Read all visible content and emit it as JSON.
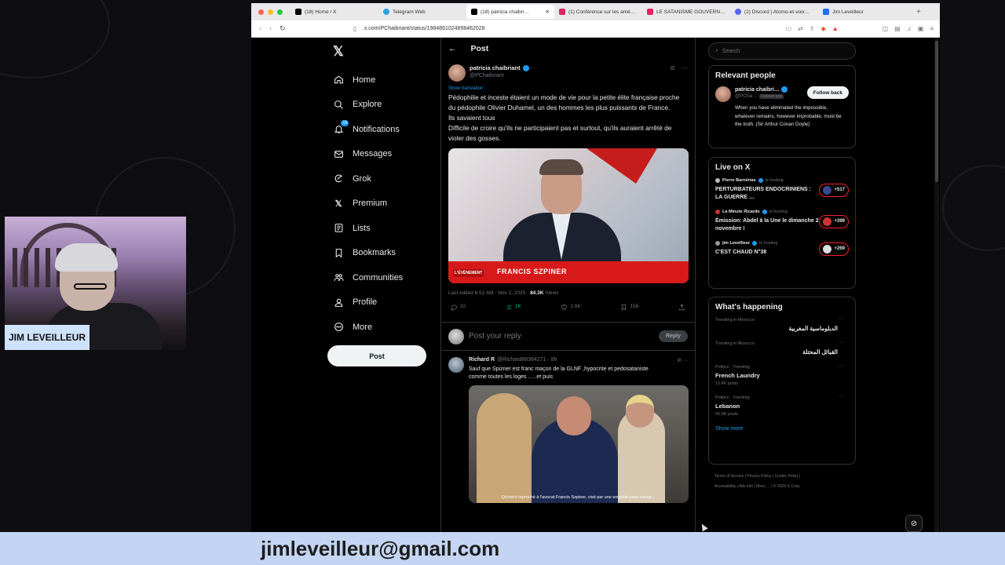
{
  "webcam": {
    "label": "JIM LEVEILLEUR"
  },
  "banner": {
    "text": "jimleveilleur@gmail.com"
  },
  "browser": {
    "tabs": [
      {
        "label": "(18) Home / X",
        "color": "#000000",
        "active": false
      },
      {
        "label": "Telegram Web",
        "color": "#2aa3df",
        "active": false
      },
      {
        "label": "(18) patricia chaibri…",
        "color": "#000000",
        "active": true
      },
      {
        "label": "(1) Conférence sur les amé…",
        "color": "#e0245e",
        "active": false
      },
      {
        "label": "LE SATANISME GOUVERN…",
        "color": "#e0245e",
        "active": false
      },
      {
        "label": "(2) Discord | Atomo-et-voix…",
        "color": "#5865f2",
        "active": false
      },
      {
        "label": "Jim Leveilleur",
        "color": "#1a73e8",
        "active": false
      }
    ],
    "url": "x.com/PChaibriant/status/1984861024898462028"
  },
  "nav": {
    "items": [
      {
        "label": "Home",
        "icon": "home-icon"
      },
      {
        "label": "Explore",
        "icon": "search-icon"
      },
      {
        "label": "Notifications",
        "icon": "bell-icon",
        "badge": "18"
      },
      {
        "label": "Messages",
        "icon": "envelope-icon"
      },
      {
        "label": "Grok",
        "icon": "grok-icon"
      },
      {
        "label": "Premium",
        "icon": "x-icon"
      },
      {
        "label": "Lists",
        "icon": "list-icon"
      },
      {
        "label": "Bookmarks",
        "icon": "bookmark-icon"
      },
      {
        "label": "Communities",
        "icon": "people-icon"
      },
      {
        "label": "Profile",
        "icon": "person-icon"
      },
      {
        "label": "More",
        "icon": "more-icon"
      }
    ],
    "post_label": "Post"
  },
  "post": {
    "header": "Post",
    "author_name": "patricia chaibriant",
    "author_handle": "@PChaibriant",
    "show_translation": "Show translation",
    "text": "Pédophilie et inceste étaient un mode de vie pour la petite élite française proche du pédophile Olivier Duhamel, un des hommes les plus puissants de France.\nIls savaient tous\nDifficile de croire qu'ils ne participaient pas et surtout, qu'ils auraient arrêté de violer des gosses.",
    "media_caption": "FRANCIS SZPINER",
    "media_logo": "L'ÉVÈNEMENT",
    "edited": "Last edited 6:51 AM · Nov 2, 2025 · ",
    "views_count": "84.3K",
    "views_label": " Views",
    "stats": {
      "replies": "32",
      "reposts": "1K",
      "likes": "1.6K",
      "bookmarks": "156"
    },
    "reply_placeholder": "Post your reply",
    "reply_button": "Reply"
  },
  "reply": {
    "name": "Richard R",
    "handle": "@Richard88384271 · 8h",
    "text": "Sauf que Spizner est franc maçon de la GLNF ,hypocrite et pedosataniste\ncomme toutes les loges …..et puis",
    "media_caption": "Qu'est-il reproché à l'avocat Francis Szpiner, visé par une enquête pour corrup…"
  },
  "search": {
    "placeholder": "Search"
  },
  "relevant": {
    "title": "Relevant people",
    "name": "patricia chaibri…",
    "handle": "@PChai…",
    "follows_you": "Follows you",
    "follow_button": "Follow back",
    "bio": "When you have eliminated the impossible, whatever remains, however improbable, must be the truth. (Sir Arthur Conan Doyle)"
  },
  "live": {
    "title": "Live on X",
    "items": [
      {
        "host": "Pierre Barnérias",
        "status": "is hosting",
        "title": "PERTURBATEURS ENDOCRINIENS : LA GUERRE …",
        "count": "+517"
      },
      {
        "host": "La Minute Ricardo",
        "status": "is hosting",
        "title": "Émission: Abdel à la Une le dimanche 2 novembre !",
        "count": "+399"
      },
      {
        "host": "jim Leveilleur",
        "status": "is hosting",
        "title": "C'EST CHAUD N°38",
        "count": "+269"
      }
    ]
  },
  "happening": {
    "title": "What's happening",
    "trends": [
      {
        "context": "Trending in Morocco",
        "title": "الدبلوماسية المغربية",
        "posts": "",
        "rtl": true
      },
      {
        "context": "Trending in Morocco",
        "title": "القبائل المحتلة",
        "posts": "",
        "rtl": true
      },
      {
        "context": "Politics · Trending",
        "title": "French Laundry",
        "posts": "12.4K posts",
        "rtl": false
      },
      {
        "context": "Politics · Trending",
        "title": "Lebanon",
        "posts": "50.9K posts",
        "rtl": false
      }
    ],
    "show_more": "Show more"
  },
  "footer": {
    "links": "Terms of Service  |  Privacy Policy  |  Cookie Policy  |\nAccessibility  |  Ads info  |  More …  |  © 2025 X Corp."
  }
}
